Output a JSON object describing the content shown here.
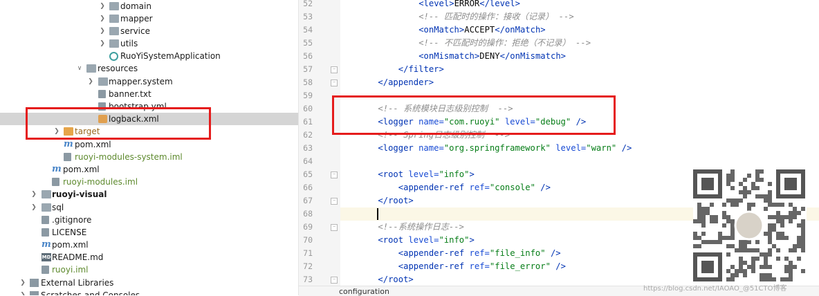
{
  "project_tree": {
    "items": [
      {
        "label": "domain",
        "icon": "folder-icon",
        "kind": "folder"
      },
      {
        "label": "mapper",
        "icon": "folder-icon",
        "kind": "folder"
      },
      {
        "label": "service",
        "icon": "folder-icon",
        "kind": "folder"
      },
      {
        "label": "utils",
        "icon": "folder-icon",
        "kind": "folder"
      },
      {
        "label": "RuoYiSystemApplication",
        "icon": "spring-class-icon",
        "kind": "class"
      },
      {
        "label": "resources",
        "icon": "resources-folder-icon",
        "kind": "folder"
      },
      {
        "label": "mapper.system",
        "icon": "folder-icon",
        "kind": "folder"
      },
      {
        "label": "banner.txt",
        "icon": "text-file-icon",
        "kind": "file"
      },
      {
        "label": "bootstrap.yml",
        "icon": "yaml-file-icon",
        "kind": "file"
      },
      {
        "label": "logback.xml",
        "icon": "xml-file-icon",
        "kind": "file"
      },
      {
        "label": "target",
        "icon": "folder-icon",
        "kind": "folder"
      },
      {
        "label": "pom.xml",
        "icon": "maven-icon",
        "kind": "file"
      },
      {
        "label": "ruoyi-modules-system.iml",
        "icon": "iml-file-icon",
        "kind": "file"
      },
      {
        "label": "pom.xml",
        "icon": "maven-icon",
        "kind": "file"
      },
      {
        "label": "ruoyi-modules.iml",
        "icon": "iml-file-icon",
        "kind": "file"
      },
      {
        "label": "ruoyi-visual",
        "icon": "module-folder-icon",
        "kind": "module"
      },
      {
        "label": "sql",
        "icon": "folder-icon",
        "kind": "folder"
      },
      {
        "label": ".gitignore",
        "icon": "gitignore-file-icon",
        "kind": "file"
      },
      {
        "label": "LICENSE",
        "icon": "text-file-icon",
        "kind": "file"
      },
      {
        "label": "pom.xml",
        "icon": "maven-icon",
        "kind": "file"
      },
      {
        "label": "README.md",
        "icon": "markdown-file-icon",
        "kind": "file"
      },
      {
        "label": "ruoyi.iml",
        "icon": "iml-file-icon",
        "kind": "file"
      },
      {
        "label": "External Libraries",
        "icon": "library-icon",
        "kind": "folder"
      },
      {
        "label": "Scratches and Consoles",
        "icon": "scratch-icon",
        "kind": "folder"
      }
    ]
  },
  "editor": {
    "line_numbers": [
      "52",
      "53",
      "54",
      "55",
      "56",
      "57",
      "58",
      "59",
      "60",
      "61",
      "62",
      "63",
      "64",
      "65",
      "66",
      "67",
      "68",
      "69",
      "70",
      "71",
      "72",
      "73"
    ],
    "lines": [
      {
        "indent": "            ",
        "parts": [
          {
            "t": "tag",
            "s": "<level>"
          },
          {
            "t": "txt",
            "s": "ERROR"
          },
          {
            "t": "tag",
            "s": "</level>"
          }
        ]
      },
      {
        "indent": "            ",
        "parts": [
          {
            "t": "cmt",
            "s": "<!-- 匹配时的操作：接收（记录） -->"
          }
        ]
      },
      {
        "indent": "            ",
        "parts": [
          {
            "t": "tag",
            "s": "<onMatch>"
          },
          {
            "t": "txt",
            "s": "ACCEPT"
          },
          {
            "t": "tag",
            "s": "</onMatch>"
          }
        ]
      },
      {
        "indent": "            ",
        "parts": [
          {
            "t": "cmt",
            "s": "<!-- 不匹配时的操作：拒绝（不记录） -->"
          }
        ]
      },
      {
        "indent": "            ",
        "parts": [
          {
            "t": "tag",
            "s": "<onMismatch>"
          },
          {
            "t": "txt",
            "s": "DENY"
          },
          {
            "t": "tag",
            "s": "</onMismatch>"
          }
        ]
      },
      {
        "indent": "        ",
        "parts": [
          {
            "t": "tag",
            "s": "</filter>"
          }
        ]
      },
      {
        "indent": "    ",
        "parts": [
          {
            "t": "tag",
            "s": "</appender>"
          }
        ]
      },
      {
        "indent": "",
        "parts": []
      },
      {
        "indent": "    ",
        "parts": [
          {
            "t": "cmt",
            "s": "<!-- 系统模块日志级别控制  -->"
          }
        ]
      },
      {
        "indent": "    ",
        "parts": [
          {
            "t": "tag",
            "s": "<logger "
          },
          {
            "t": "attr",
            "s": "name="
          },
          {
            "t": "val",
            "s": "\"com.ruoyi\""
          },
          {
            "t": "txt",
            "s": " "
          },
          {
            "t": "attr",
            "s": "level="
          },
          {
            "t": "val",
            "s": "\"debug\""
          },
          {
            "t": "tag",
            "s": " />"
          }
        ]
      },
      {
        "indent": "    ",
        "parts": [
          {
            "t": "cmt",
            "s": "<!-- Spring日志级别控制  -->"
          }
        ]
      },
      {
        "indent": "    ",
        "parts": [
          {
            "t": "tag",
            "s": "<logger "
          },
          {
            "t": "attr",
            "s": "name="
          },
          {
            "t": "val",
            "s": "\"org.springframework\""
          },
          {
            "t": "txt",
            "s": " "
          },
          {
            "t": "attr",
            "s": "level="
          },
          {
            "t": "val",
            "s": "\"warn\""
          },
          {
            "t": "tag",
            "s": " />"
          }
        ]
      },
      {
        "indent": "",
        "parts": []
      },
      {
        "indent": "    ",
        "parts": [
          {
            "t": "tag",
            "s": "<root "
          },
          {
            "t": "attr",
            "s": "level="
          },
          {
            "t": "val",
            "s": "\"info\""
          },
          {
            "t": "tag",
            "s": ">"
          }
        ]
      },
      {
        "indent": "        ",
        "parts": [
          {
            "t": "tag",
            "s": "<appender-ref "
          },
          {
            "t": "attr",
            "s": "ref="
          },
          {
            "t": "val",
            "s": "\"console\""
          },
          {
            "t": "tag",
            "s": " />"
          }
        ]
      },
      {
        "indent": "    ",
        "parts": [
          {
            "t": "tag",
            "s": "</root>"
          }
        ]
      },
      {
        "indent": "",
        "parts": []
      },
      {
        "indent": "    ",
        "parts": [
          {
            "t": "cmt",
            "s": "<!--系统操作日志-->"
          }
        ]
      },
      {
        "indent": "    ",
        "parts": [
          {
            "t": "tag",
            "s": "<root "
          },
          {
            "t": "attr",
            "s": "level="
          },
          {
            "t": "val",
            "s": "\"info\""
          },
          {
            "t": "tag",
            "s": ">"
          }
        ]
      },
      {
        "indent": "        ",
        "parts": [
          {
            "t": "tag",
            "s": "<appender-ref "
          },
          {
            "t": "attr",
            "s": "ref="
          },
          {
            "t": "val",
            "s": "\"file_info\""
          },
          {
            "t": "tag",
            "s": " />"
          }
        ]
      },
      {
        "indent": "        ",
        "parts": [
          {
            "t": "tag",
            "s": "<appender-ref "
          },
          {
            "t": "attr",
            "s": "ref="
          },
          {
            "t": "val",
            "s": "\"file_error\""
          },
          {
            "t": "tag",
            "s": " />"
          }
        ]
      },
      {
        "indent": "    ",
        "parts": [
          {
            "t": "tag",
            "s": "</root>"
          }
        ]
      }
    ]
  },
  "status_bar": {
    "breadcrumb": "configuration"
  },
  "watermark": {
    "text": "https://blog.csdn.net/IAOAO_@51CTO博客"
  },
  "colors": {
    "tag": "#0033b3",
    "attr": "#174ad4",
    "value": "#067d17",
    "comment": "#8c8c8c",
    "highlight_box": "#e51c1c",
    "selection": "#d5d5d5"
  }
}
